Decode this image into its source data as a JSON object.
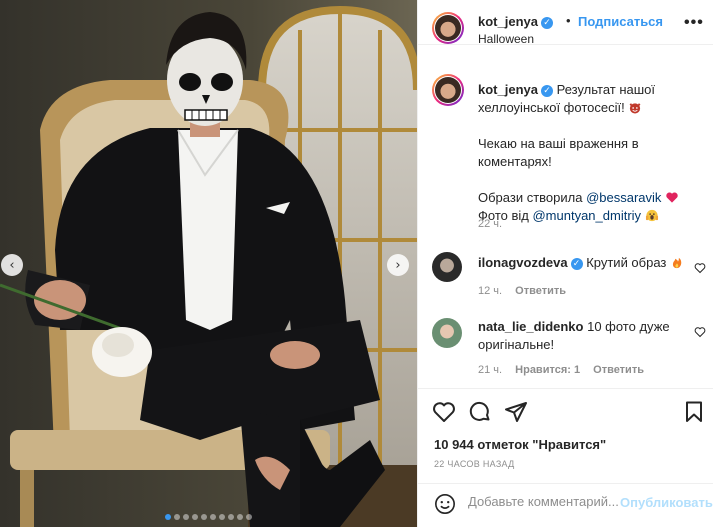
{
  "post": {
    "username": "kot_jenya",
    "follow_label": "Подписаться",
    "location": "Halloween",
    "more_label": "•••",
    "separator": "•"
  },
  "caption": {
    "username": "kot_jenya",
    "line1": " Результат нашої хеллоуінської фотосесії!",
    "line2": "Чекаю на ваші враження в коментарях!",
    "line3_prefix": "Образи створила ",
    "line3_mention": "@bessaravik",
    "line4_prefix": "Фото від ",
    "line4_mention": "@muntyan_dmitriy",
    "time": "22 ч."
  },
  "comments": [
    {
      "username": "ilonagvozdeva",
      "text": " Крутий образ",
      "time": "12 ч.",
      "reply": "Ответить"
    },
    {
      "username": "nata_lie_didenko",
      "text": " 10 фото дуже оригінальне!",
      "time": "21 ч.",
      "likes": "Нравится: 1",
      "reply": "Ответить"
    }
  ],
  "engagement": {
    "likes_text": "10 944 отметок \"Нравится\"",
    "posted_ago": "22 ЧАСОВ НАЗАД"
  },
  "comment_box": {
    "placeholder": "Добавьте комментарий...",
    "publish_label": "Опубликовать"
  },
  "carousel": {
    "dot_count": 10,
    "active_index": 0
  },
  "icons": {
    "prev": "chevron-left-icon",
    "next": "chevron-right-icon",
    "like": "heart-icon",
    "comment": "comment-icon",
    "share": "paper-plane-icon",
    "save": "bookmark-icon",
    "emoji": "smiley-icon"
  },
  "colors": {
    "accent": "#3897f0",
    "mention": "#00376b",
    "muted": "#8e8e8e",
    "publish_disabled": "#b2dffc"
  }
}
